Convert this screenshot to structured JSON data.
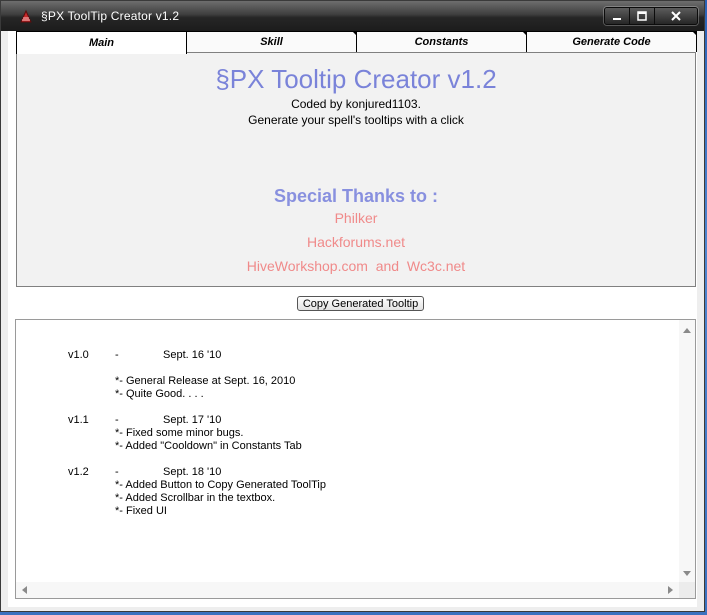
{
  "window": {
    "title": "§PX ToolTip Creator v1.2",
    "icon": "app-icon"
  },
  "tabs": [
    {
      "label": "Main",
      "active": true
    },
    {
      "label": "Skill",
      "active": false
    },
    {
      "label": "Constants",
      "active": false
    },
    {
      "label": "Generate Code",
      "active": false
    }
  ],
  "main": {
    "title": "§PX Tooltip Creator v1.2",
    "coded_by": "Coded by konjured1103.",
    "tagline": "Generate your spell's tooltips with a click",
    "thanks_heading": "Special Thanks to :",
    "thanks": [
      "Philker",
      "Hackforums.net",
      "HiveWorkshop.com  and  Wc3c.net"
    ]
  },
  "copy_button_label": "Copy Generated Tooltip",
  "changelog": [
    {
      "version": "v1.0",
      "dash": "-",
      "date": "Sept. 16 '10",
      "notes": [
        "*- General Release at Sept. 16, 2010",
        "*- Quite Good. . . ."
      ]
    },
    {
      "version": "v1.1",
      "dash": "-",
      "date": "Sept. 17 '10",
      "notes": [
        "*- Fixed some minor bugs.",
        "*- Added \"Cooldown\" in Constants Tab"
      ]
    },
    {
      "version": "v1.2",
      "dash": "-",
      "date": "Sept. 18 '10",
      "notes": [
        "*- Added Button to Copy Generated ToolTip",
        "*- Added Scrollbar in the textbox.",
        "*- Fixed UI"
      ]
    }
  ],
  "colors": {
    "title_blue": "#7a83d9",
    "thanks_pink": "#f08a8a"
  }
}
